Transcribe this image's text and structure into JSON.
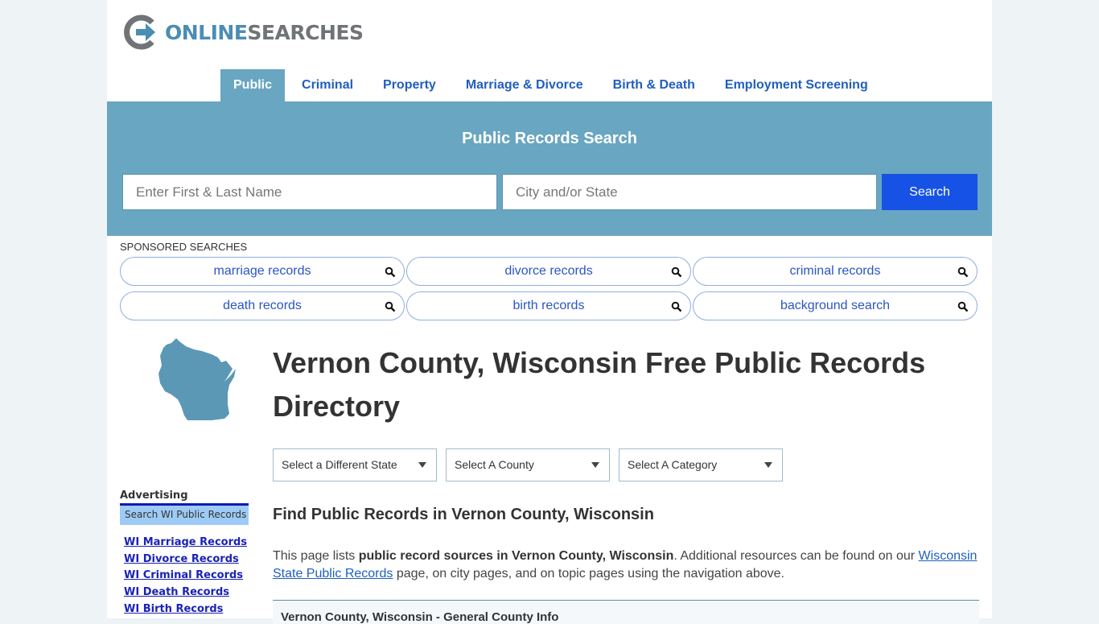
{
  "logo": {
    "part1": "ONLINE",
    "part2": "SEARCHES"
  },
  "nav": [
    {
      "label": "Public",
      "active": true
    },
    {
      "label": "Criminal"
    },
    {
      "label": "Property"
    },
    {
      "label": "Marriage & Divorce"
    },
    {
      "label": "Birth & Death"
    },
    {
      "label": "Employment Screening"
    }
  ],
  "hero": {
    "title": "Public Records Search",
    "name_placeholder": "Enter First & Last Name",
    "location_placeholder": "City and/or State",
    "search_label": "Search"
  },
  "sponsored": {
    "label": "SPONSORED SEARCHES",
    "items": [
      "marriage records",
      "divorce records",
      "criminal records",
      "death records",
      "birth records",
      "background search"
    ]
  },
  "main": {
    "title": "Vernon County, Wisconsin Free Public Records Directory",
    "selects": [
      "Select a Different State",
      "Select A County",
      "Select A Category"
    ],
    "subtitle": "Find Public Records in Vernon County, Wisconsin",
    "intro": {
      "prefix": "This page lists ",
      "bold": "public record sources in Vernon County, Wisconsin",
      "middle": ". Additional resources can be found on our ",
      "link": "Wisconsin State Public Records",
      "suffix": " page, on city pages, and on topic pages using the navigation above."
    },
    "info_box_title": "Vernon County, Wisconsin - General County Info"
  },
  "sidebar": {
    "ad_label": "Advertising",
    "ad_heading": "Search WI Public Records",
    "links": [
      "WI Marriage Records",
      "WI Divorce Records",
      "WI Criminal Records",
      "WI Death Records",
      "WI Birth Records"
    ]
  },
  "colors": {
    "brand": "#69a6c1",
    "search_button": "#1652e5",
    "link": "#1f5fbf"
  }
}
